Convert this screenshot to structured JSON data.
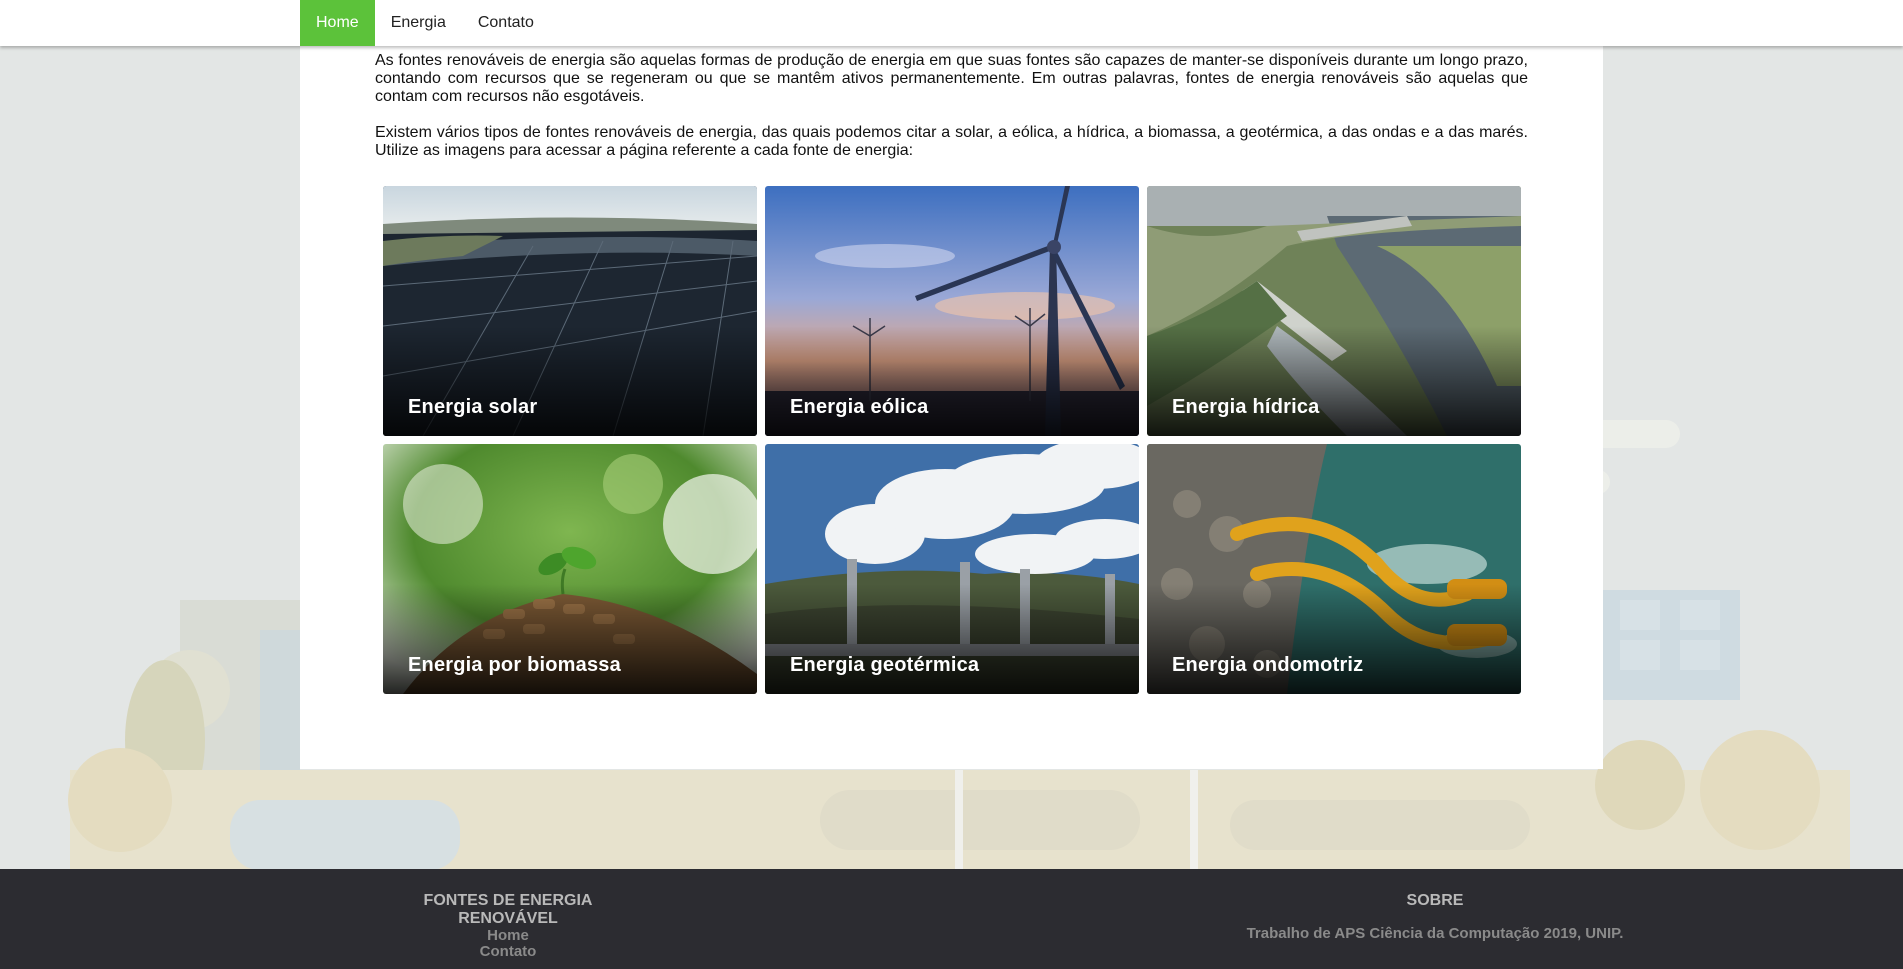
{
  "nav": {
    "items": [
      {
        "label": "Home",
        "active": true
      },
      {
        "label": "Energia",
        "active": false
      },
      {
        "label": "Contato",
        "active": false
      }
    ]
  },
  "intro": {
    "paragraph_1": "As fontes renováveis de energia são aquelas formas de produção de energia em que suas fontes são capazes de manter-se disponíveis durante um longo prazo, contando com recursos que se regeneram ou que se mantêm ativos permanentemente. Em outras palavras, fontes de energia renováveis são aquelas que contam com recursos não esgotáveis.",
    "paragraph_2": "Existem vários tipos de fontes renováveis de energia, das quais podemos citar a solar, a eólica, a hídrica, a biomassa, a geotérmica, a das ondas e a das marés. Utilize as imagens para acessar a página referente a cada fonte de energia:"
  },
  "tiles": [
    {
      "label": "Energia solar",
      "image": "solar-panels-image"
    },
    {
      "label": "Energia eólica",
      "image": "wind-turbine-image"
    },
    {
      "label": "Energia hídrica",
      "image": "hydroelectric-dam-image"
    },
    {
      "label": "Energia por biomassa",
      "image": "biomass-pellets-image"
    },
    {
      "label": "Energia geotérmica",
      "image": "geothermal-plant-image"
    },
    {
      "label": "Energia ondomotriz",
      "image": "wave-energy-machine-image"
    }
  ],
  "footer": {
    "left_title": "FONTES DE ENERGIA RENOVÁVEL",
    "left_links": [
      "Home",
      "Contato"
    ],
    "right_title": "SOBRE",
    "right_text": "Trabalho de APS Ciência da Computação 2019, UNIP."
  },
  "colors": {
    "accent": "#5cc23a",
    "footer_bg": "#2c2c31",
    "page_bg": "#e3e6e5"
  }
}
